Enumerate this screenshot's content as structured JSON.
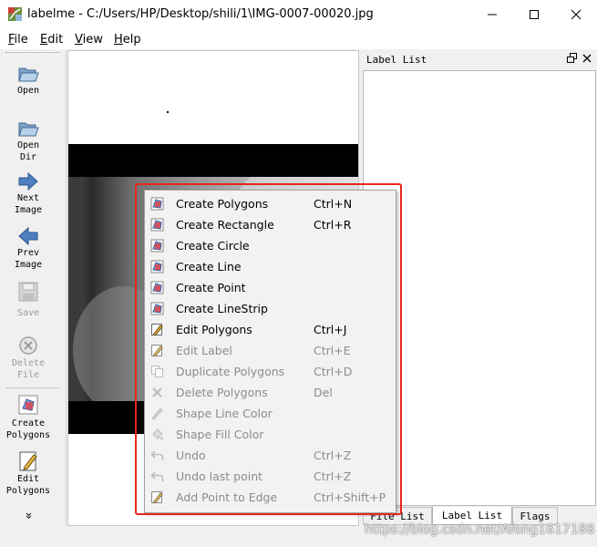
{
  "window": {
    "title": "labelme - C:/Users/HP/Desktop/shili/1\\IMG-0007-00020.jpg",
    "minimize_icon": "minimize-icon",
    "maximize_icon": "maximize-icon",
    "close_icon": "close-icon"
  },
  "menu": [
    {
      "label": "File",
      "u": "F",
      "rest": "ile"
    },
    {
      "label": "Edit",
      "u": "E",
      "rest": "dit"
    },
    {
      "label": "View",
      "u": "V",
      "rest": "iew"
    },
    {
      "label": "Help",
      "u": "H",
      "rest": "elp"
    }
  ],
  "toolbar": {
    "open": "Open",
    "open_dir": "Open\nDir",
    "next_image": "Next\nImage",
    "prev_image": "Prev\nImage",
    "save": "Save",
    "delete_file": "Delete\nFile",
    "create_polygons": "Create\nPolygons",
    "edit_polygons": "Edit\nPolygons",
    "more": "»"
  },
  "dock": {
    "title": "Label List",
    "tabs": [
      "File List",
      "Label List",
      "Flags"
    ],
    "active_tab": "Label List"
  },
  "context_menu": {
    "items": [
      {
        "label": "Create Polygons",
        "shortcut": "Ctrl+N",
        "enabled": true,
        "icon": "create-shape-icon"
      },
      {
        "label": "Create Rectangle",
        "shortcut": "Ctrl+R",
        "enabled": true,
        "icon": "create-shape-icon"
      },
      {
        "label": "Create Circle",
        "shortcut": "",
        "enabled": true,
        "icon": "create-shape-icon"
      },
      {
        "label": "Create Line",
        "shortcut": "",
        "enabled": true,
        "icon": "create-shape-icon"
      },
      {
        "label": "Create Point",
        "shortcut": "",
        "enabled": true,
        "icon": "create-shape-icon"
      },
      {
        "label": "Create LineStrip",
        "shortcut": "",
        "enabled": true,
        "icon": "create-shape-icon"
      },
      {
        "label": "Edit Polygons",
        "shortcut": "Ctrl+J",
        "enabled": true,
        "icon": "edit-icon"
      },
      {
        "label": "Edit Label",
        "shortcut": "Ctrl+E",
        "enabled": false,
        "icon": "edit-icon"
      },
      {
        "label": "Duplicate Polygons",
        "shortcut": "Ctrl+D",
        "enabled": false,
        "icon": "copy-icon"
      },
      {
        "label": "Delete Polygons",
        "shortcut": "Del",
        "enabled": false,
        "icon": "cancel-icon"
      },
      {
        "label": "Shape Line Color",
        "shortcut": "",
        "enabled": false,
        "icon": "pen-icon"
      },
      {
        "label": "Shape Fill Color",
        "shortcut": "",
        "enabled": false,
        "icon": "fill-icon"
      },
      {
        "label": "Undo",
        "shortcut": "Ctrl+Z",
        "enabled": false,
        "icon": "undo-icon"
      },
      {
        "label": "Undo last point",
        "shortcut": "Ctrl+Z",
        "enabled": false,
        "icon": "undo-icon"
      },
      {
        "label": "Add Point to Edge",
        "shortcut": "Ctrl+Shift+P",
        "enabled": false,
        "icon": "edit-icon"
      }
    ]
  },
  "watermark": "https://blog.csdn.net/Afong1617188",
  "colors": {
    "highlight_box": "#e8261f",
    "disabled_text": "#8c8c8c"
  }
}
